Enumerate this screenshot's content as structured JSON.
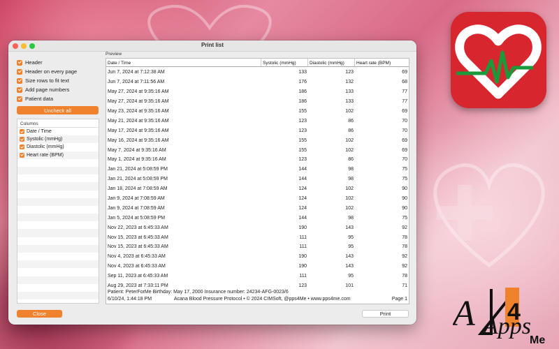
{
  "window": {
    "title": "Print list"
  },
  "options": [
    {
      "label": "Header",
      "checked": true
    },
    {
      "label": "Header on every page",
      "checked": true
    },
    {
      "label": "Size rows to fit text",
      "checked": true
    },
    {
      "label": "Add page numbers",
      "checked": true
    },
    {
      "label": "Patient data",
      "checked": true
    }
  ],
  "uncheck_label": "Uncheck all",
  "columns": {
    "header": "Columns",
    "items": [
      "Date / Time",
      "Systolic (mmHg)",
      "Diastolic (mmHg)",
      "Heart rate (BPM)"
    ]
  },
  "preview": {
    "label": "Preview",
    "headers": [
      "Date / Time",
      "Systolic (mmHg)",
      "Diastolic (mmHg)",
      "Heart rate (BPM)"
    ],
    "rows": [
      [
        "Jun 7, 2024 at 7:12:38 AM",
        "133",
        "123",
        "69"
      ],
      [
        "Jun 7, 2024 at 7:11:56 AM",
        "176",
        "132",
        "68"
      ],
      [
        "May 27, 2024 at 9:35:16 AM",
        "186",
        "133",
        "77"
      ],
      [
        "May 27, 2024 at 9:35:16 AM",
        "186",
        "133",
        "77"
      ],
      [
        "May 23, 2024 at 9:35:16 AM",
        "155",
        "102",
        "69"
      ],
      [
        "May 21, 2024 at 9:35:16 AM",
        "123",
        "86",
        "70"
      ],
      [
        "May 17, 2024 at 9:35:16 AM",
        "123",
        "86",
        "70"
      ],
      [
        "May 16, 2024 at 9:35:16 AM",
        "155",
        "102",
        "69"
      ],
      [
        "May 7, 2024 at 9:35:16 AM",
        "155",
        "102",
        "69"
      ],
      [
        "May 1, 2024 at 9:35:16 AM",
        "123",
        "86",
        "70"
      ],
      [
        "Jan 21, 2024 at 5:08:59 PM",
        "144",
        "98",
        "75"
      ],
      [
        "Jan 21, 2024 at 5:08:59 PM",
        "144",
        "98",
        "75"
      ],
      [
        "Jan 18, 2024 at 7:08:59 AM",
        "124",
        "102",
        "90"
      ],
      [
        "Jan 9, 2024 at 7:08:59 AM",
        "124",
        "102",
        "90"
      ],
      [
        "Jan 9, 2024 at 7:08:59 AM",
        "124",
        "102",
        "90"
      ],
      [
        "Jan 5, 2024 at 5:08:59 PM",
        "144",
        "98",
        "75"
      ],
      [
        "Nov 22, 2023 at 6:45:33 AM",
        "190",
        "143",
        "92"
      ],
      [
        "Nov 15, 2023 at 6:45:33 AM",
        "111",
        "95",
        "78"
      ],
      [
        "Nov 15, 2023 at 6:45:33 AM",
        "111",
        "95",
        "78"
      ],
      [
        "Nov 4, 2023 at 6:45:33 AM",
        "190",
        "143",
        "92"
      ],
      [
        "Nov 4, 2023 at 6:45:33 AM",
        "190",
        "143",
        "92"
      ],
      [
        "Sep 11, 2023 at 6:45:33 AM",
        "111",
        "95",
        "78"
      ],
      [
        "Aug 29, 2023 at 7:33:11 PM",
        "123",
        "101",
        "71"
      ]
    ],
    "footer_patient": "Patient: PeterForMe  Birthday: May 17, 2000  Insurance number: 24234-AFG-0023/6",
    "footer_date": "6/10/24, 1:44:18 PM",
    "footer_copyright": "Acana Blood Pressure Protocol • © 2024 CIMSoft, @pps4Me • www.pps4me.com",
    "footer_page": "Page  1"
  },
  "close_label": "Close",
  "print_label": "Print",
  "brand": {
    "logo_text": "Apps",
    "logo_digit": "4",
    "logo_sub": "Me"
  },
  "colors": {
    "accent": "#f0822d",
    "icon_red": "#d7262e",
    "heart_line": "#1a9a3a"
  },
  "icons": [
    "heart-pulse-app-icon",
    "apps4me-logo"
  ]
}
